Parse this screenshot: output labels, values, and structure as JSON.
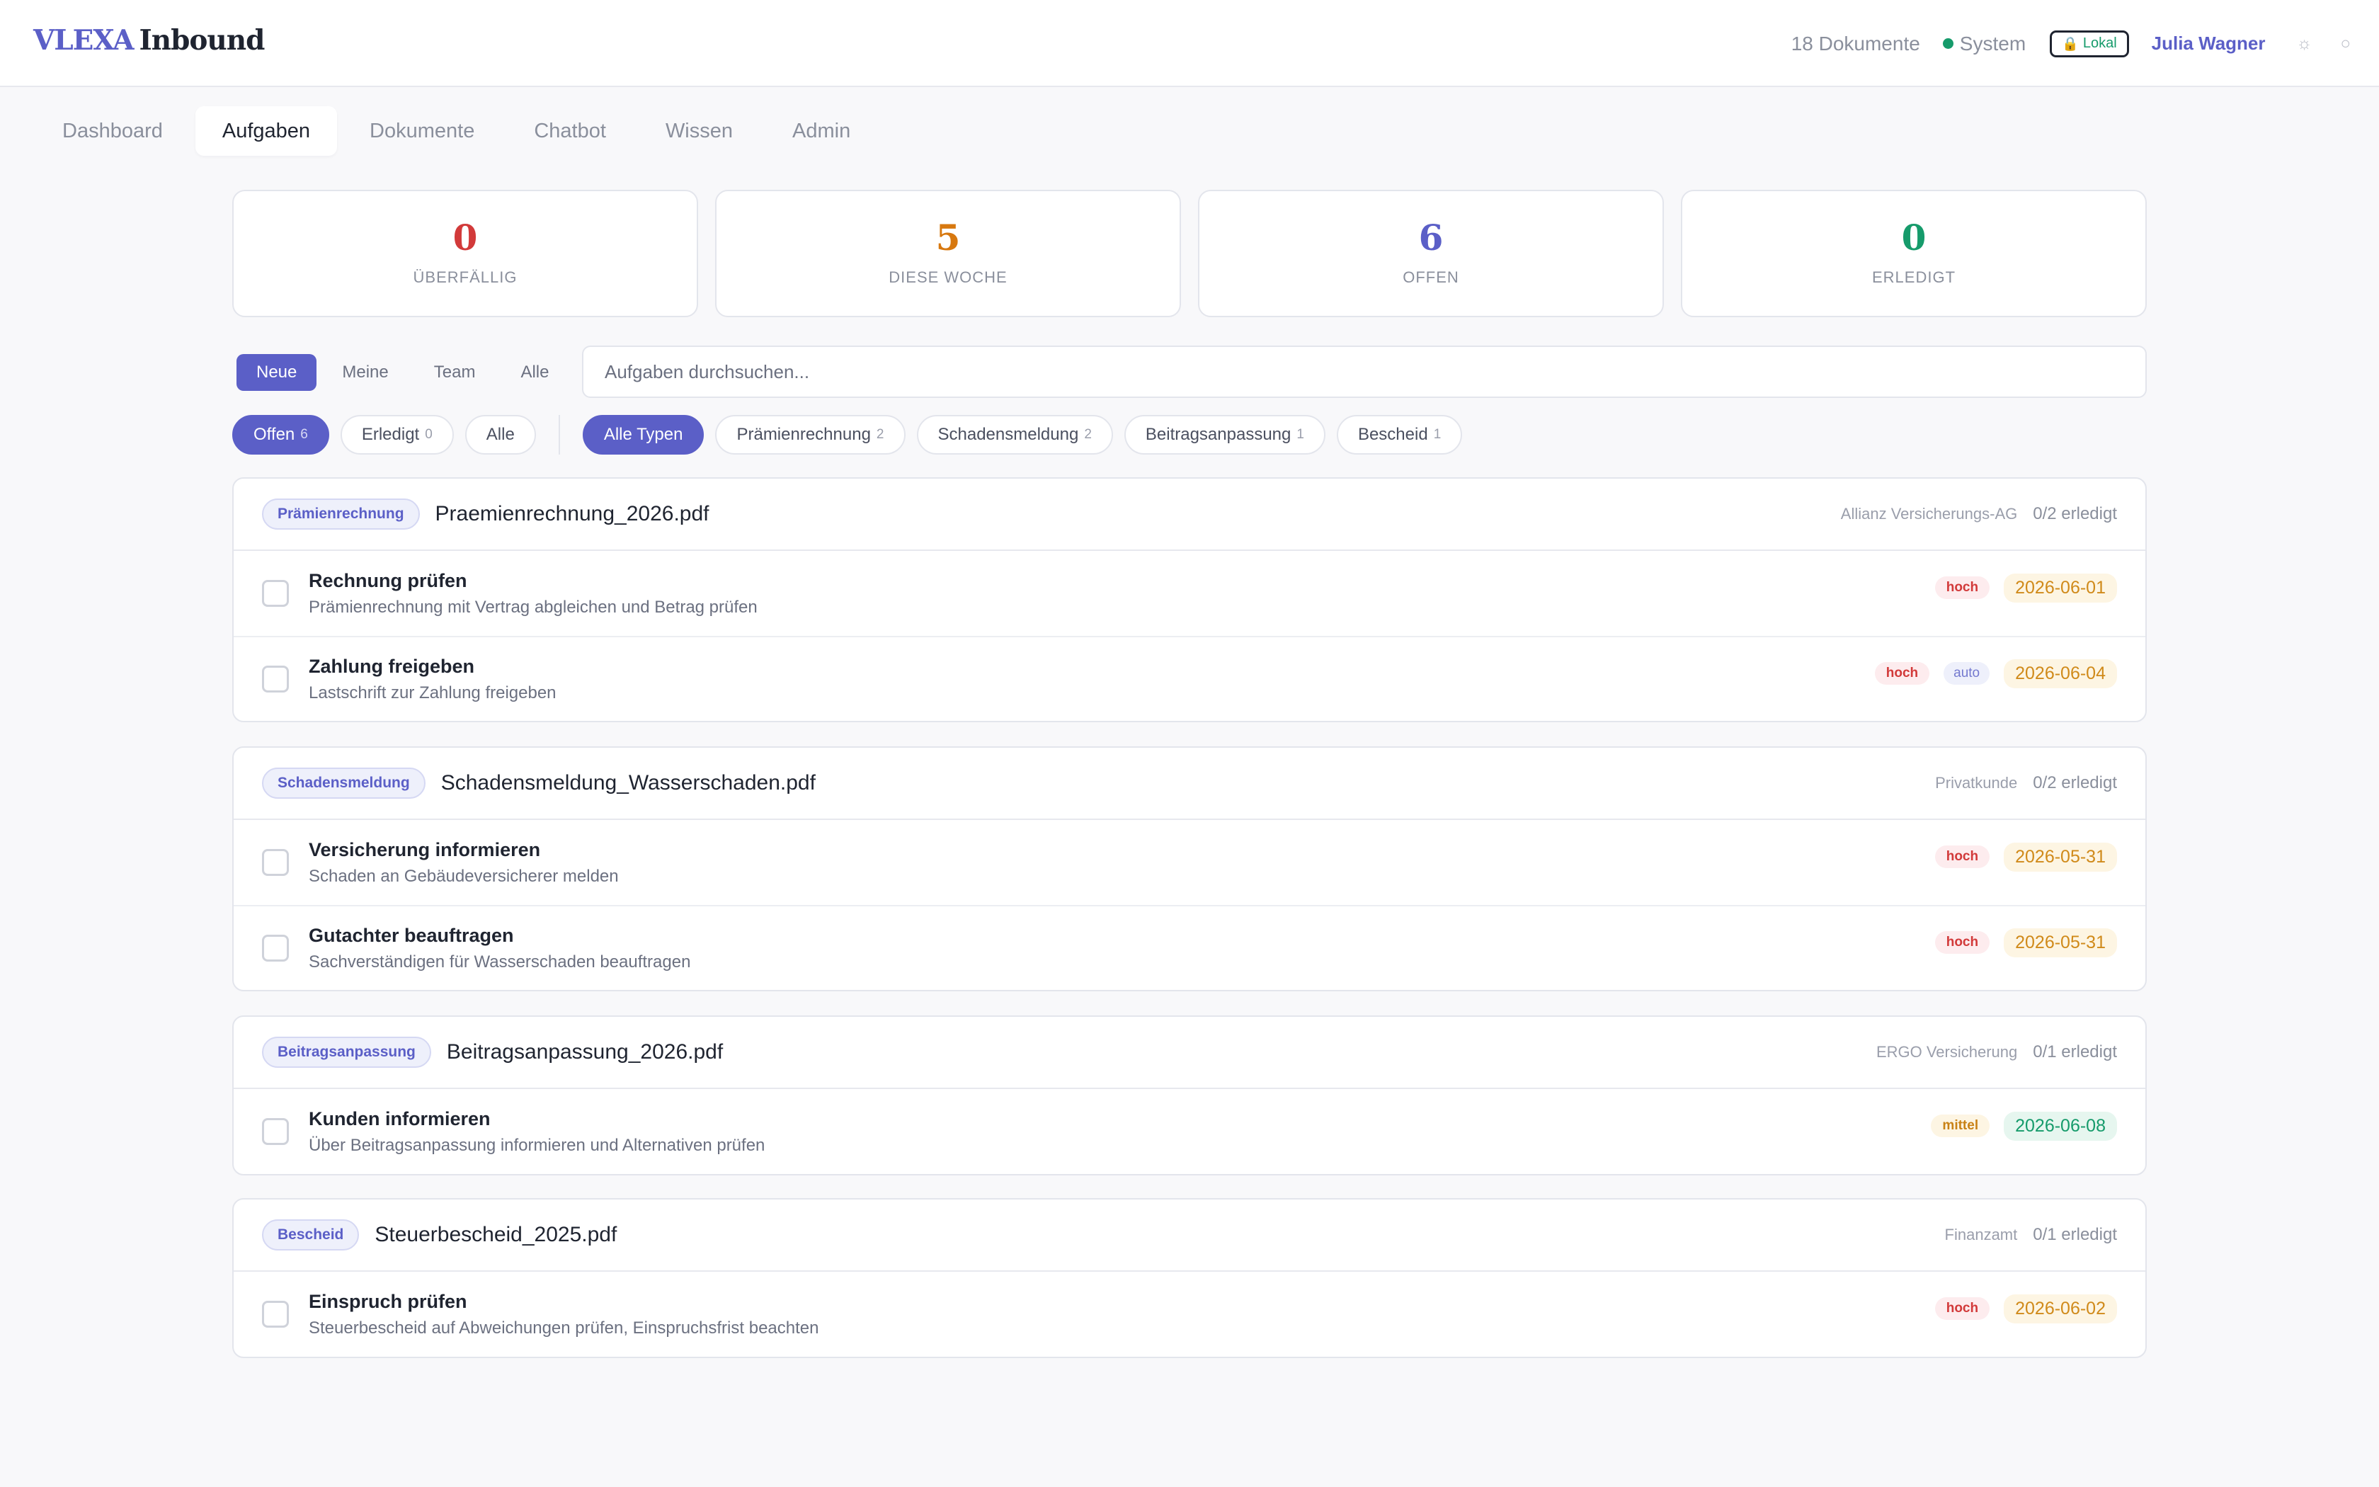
{
  "header": {
    "brand": "VLEXA",
    "app": "Inbound",
    "doc_count": "18 Dokumente",
    "system_label": "System",
    "lokal_icon": "🔒",
    "lokal_label": "Lokal",
    "user": "Julia Wagner",
    "theme_icon": "☼",
    "settings_icon": "○"
  },
  "tabs": [
    {
      "label": "Dashboard"
    },
    {
      "label": "Aufgaben"
    },
    {
      "label": "Dokumente"
    },
    {
      "label": "Chatbot"
    },
    {
      "label": "Wissen"
    },
    {
      "label": "Admin"
    }
  ],
  "stats": [
    {
      "value": "0",
      "label": "ÜBERFÄLLIG",
      "color": "#d23a3a"
    },
    {
      "value": "5",
      "label": "DIESE WOCHE",
      "color": "#d7780f"
    },
    {
      "value": "6",
      "label": "OFFEN",
      "color": "#5b5fc7"
    },
    {
      "value": "0",
      "label": "ERLEDIGT",
      "color": "#169b6b"
    }
  ],
  "scope": [
    {
      "label": "Neue"
    },
    {
      "label": "Meine"
    },
    {
      "label": "Team"
    },
    {
      "label": "Alle"
    }
  ],
  "search": {
    "placeholder": "Aufgaben durchsuchen..."
  },
  "status_filters": [
    {
      "label": "Offen",
      "count": "6"
    },
    {
      "label": "Erledigt",
      "count": "0"
    },
    {
      "label": "Alle",
      "count": ""
    }
  ],
  "type_filters": [
    {
      "label": "Alle Typen",
      "count": ""
    },
    {
      "label": "Prämienrechnung",
      "count": "2"
    },
    {
      "label": "Schadensmeldung",
      "count": "2"
    },
    {
      "label": "Beitragsanpassung",
      "count": "1"
    },
    {
      "label": "Bescheid",
      "count": "1"
    }
  ],
  "groups": [
    {
      "type": "Prämienrechnung",
      "document": "Praemienrechnung_2026.pdf",
      "sender": "Allianz Versicherungs-AG",
      "progress": "0/2 erledigt",
      "tasks": [
        {
          "title": "Rechnung prüfen",
          "desc": "Prämienrechnung mit Vertrag abgleichen und Betrag prüfen",
          "priority": "hoch",
          "due": "2026-06-01"
        },
        {
          "title": "Zahlung freigeben",
          "desc": "Lastschrift zur Zahlung freigeben",
          "priority": "hoch",
          "auto": "auto",
          "due": "2026-06-04"
        }
      ]
    },
    {
      "type": "Schadensmeldung",
      "document": "Schadensmeldung_Wasserschaden.pdf",
      "sender": "Privatkunde",
      "progress": "0/2 erledigt",
      "tasks": [
        {
          "title": "Versicherung informieren",
          "desc": "Schaden an Gebäudeversicherer melden",
          "priority": "hoch",
          "due": "2026-05-31"
        },
        {
          "title": "Gutachter beauftragen",
          "desc": "Sachverständigen für Wasserschaden beauftragen",
          "priority": "hoch",
          "due": "2026-05-31"
        }
      ]
    },
    {
      "type": "Beitragsanpassung",
      "document": "Beitragsanpassung_2026.pdf",
      "sender": "ERGO Versicherung",
      "progress": "0/1 erledigt",
      "tasks": [
        {
          "title": "Kunden informieren",
          "desc": "Über Beitragsanpassung informieren und Alternativen prüfen",
          "priority": "mittel",
          "due": "2026-06-08"
        }
      ]
    },
    {
      "type": "Bescheid",
      "document": "Steuerbescheid_2025.pdf",
      "sender": "Finanzamt",
      "progress": "0/1 erledigt",
      "tasks": [
        {
          "title": "Einspruch prüfen",
          "desc": "Steuerbescheid auf Abweichungen prüfen, Einspruchsfrist beachten",
          "priority": "hoch",
          "due": "2026-06-02"
        }
      ]
    }
  ]
}
